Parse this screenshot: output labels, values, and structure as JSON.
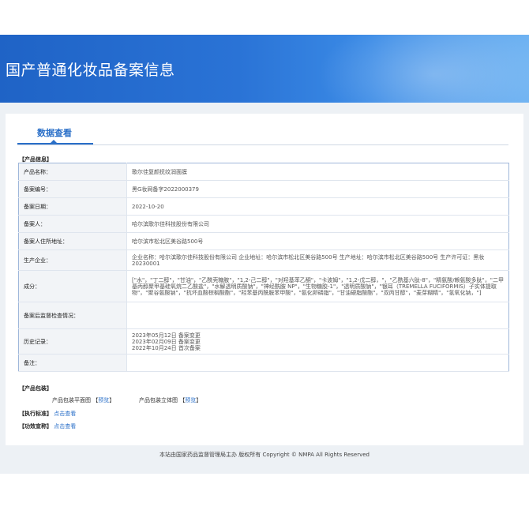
{
  "header": {
    "title": "国产普通化妆品备案信息"
  },
  "tab": {
    "label": "数据查看"
  },
  "product_info": {
    "section_label": "【产品信息】",
    "rows": [
      {
        "key": "产品名称：",
        "value": "歌尔佳复颜抚纹润面膜"
      },
      {
        "key": "备案编号：",
        "value": "黑G妆网备字2022000379"
      },
      {
        "key": "备案日期：",
        "value": "2022-10-20"
      },
      {
        "key": "备案人：",
        "value": "哈尔滨歌尔佳科技股份有限公司"
      },
      {
        "key": "备案人住所地址：",
        "value": "哈尔滨市松北区美谷路500号"
      },
      {
        "key": "生产企业：",
        "value": "企业名称：哈尔滨歌尔佳科技股份有限公司 企业地址：哈尔滨市松北区美谷路500号 生产地址：哈尔滨市松北区美谷路500号 生产许可证：黑妆20230001"
      },
      {
        "key": "成分：",
        "value": "[\"水\"，\"丁二醇\"，\"甘油\"，\"乙酰壳糖胺\"，\"1,2-己二醇\"，\"对羟基苯乙酮\"，\"卡波姆\"，\"1,2-戊二醇，\"，\"乙酰基六肽-8\"，\"精氨酸/赖氨酸多肽\"，\"二甲基丙醇聚甲基硅氧烷二乙酸盐\"，\"水解透明质酸钠\"，\"神经酰胺 NP\"，\"生物糖胶-1\"，\"透明质酸钠\"，\"银耳（TREMELLA FUCIFORMIS）子实体提取物\"，\"聚谷氨酸钠\"，\"抗坏血酸棕榈酸酯\"，\"羟苯基丙酰胺苯甲酸\"，\"氨化卵磷脂\"，\"甘油硬脂酸酯\"，\"双丙甘醇\"，\"麦芽糊精\"，\"氢氧化钠，\"]"
      },
      {
        "key": "备案后监督检查情况：",
        "value": ""
      },
      {
        "key": "历史记录：",
        "value": "2023年05月12日 备案变更\n2023年02月09日 备案变更\n2022年10月24日 首次备案"
      },
      {
        "key": "备注：",
        "value": ""
      }
    ]
  },
  "packaging": {
    "section_label": "【产品包装】",
    "flat_label": "产品包装平面图",
    "stereo_label": "产品包装立体图",
    "bracket_open": "【",
    "bracket_close": "】",
    "preview_label": "预览"
  },
  "standard": {
    "label": "【执行标准】",
    "link": "点击查看"
  },
  "efficacy": {
    "label": "【功效宣称】",
    "link": "点击查看"
  },
  "footer": {
    "text": "本站由国家药品监督管理局主办 版权所有 Copyright © NMPA All Rights Reserved"
  }
}
